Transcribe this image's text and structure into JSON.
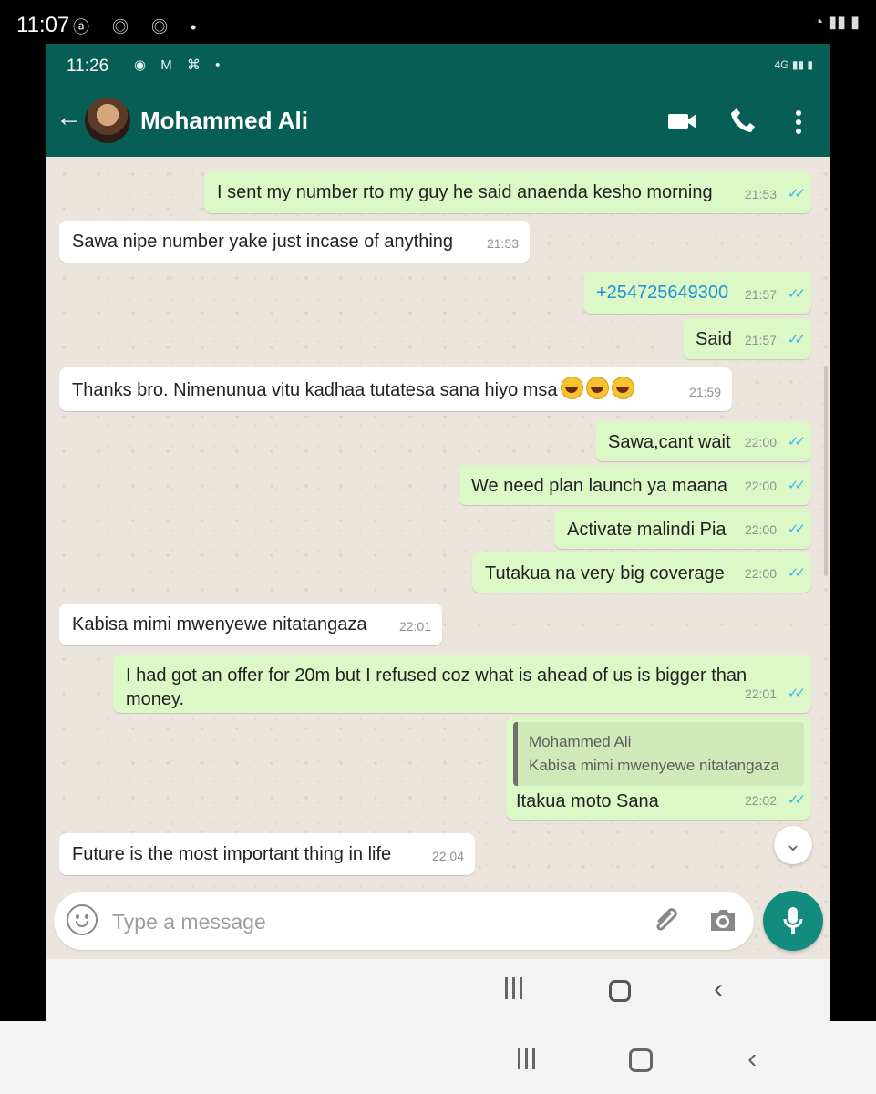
{
  "outer_status": {
    "time": "11:07",
    "icons": "ⓐ ◎ ◎ •",
    "right": "◔ ▮▮ ▮"
  },
  "inner_status": {
    "time": "11:26",
    "icons": "◉ M ⌘ •",
    "right": "4G ▮▮ ▮"
  },
  "header": {
    "contact_name": "Mohammed Ali"
  },
  "messages": [
    {
      "text": "I sent my number rto my guy he said anaenda kesho morning",
      "time": "21:53",
      "ticks": "✓✓"
    },
    {
      "text": "Sawa nipe number yake just incase of anything",
      "time": "21:53"
    },
    {
      "text": "+254725649300",
      "time": "21:57",
      "ticks": "✓✓"
    },
    {
      "text": "Said",
      "time": "21:57",
      "ticks": "✓✓"
    },
    {
      "text": "Thanks bro. Nimenunua vitu kadhaa tutatesa sana hiyo msa",
      "time": "21:59"
    },
    {
      "text": "Sawa,cant wait",
      "time": "22:00",
      "ticks": "✓✓"
    },
    {
      "text": "We need plan launch ya maana",
      "time": "22:00",
      "ticks": "✓✓"
    },
    {
      "text": "Activate malindi Pia",
      "time": "22:00",
      "ticks": "✓✓"
    },
    {
      "text": "Tutakua na very big coverage",
      "time": "22:00",
      "ticks": "✓✓"
    },
    {
      "text": "Kabisa mimi mwenyewe nitatangaza",
      "time": "22:01"
    },
    {
      "text": "I had got an offer for 20m  but I refused coz what is ahead of us is bigger than money.",
      "time": "22:01",
      "ticks": "✓✓"
    },
    {
      "quote_name": "Mohammed Ali",
      "quote_text": "Kabisa mimi mwenyewe nitatangaza",
      "text": "Itakua moto Sana",
      "time": "22:02",
      "ticks": "✓✓"
    },
    {
      "text": "Future is the most important thing in life",
      "time": "22:04"
    }
  ],
  "composer": {
    "placeholder": "Type a message"
  },
  "icons": {
    "back": "back-arrow-icon",
    "video": "video-camera-icon",
    "call": "phone-icon",
    "menu": "more-vert-icon",
    "scroll_down": "chevron-double-down-icon",
    "emoji": "emoji-icon",
    "attach": "paperclip-icon",
    "camera": "camera-icon",
    "mic": "microphone-icon"
  },
  "colors": {
    "header": "#075e54",
    "outgoing_bubble": "#dcf8c6",
    "incoming_bubble": "#ffffff",
    "read_ticks": "#34b7f1",
    "mic_button": "#128c7e",
    "chat_background": "#ece5dd"
  }
}
